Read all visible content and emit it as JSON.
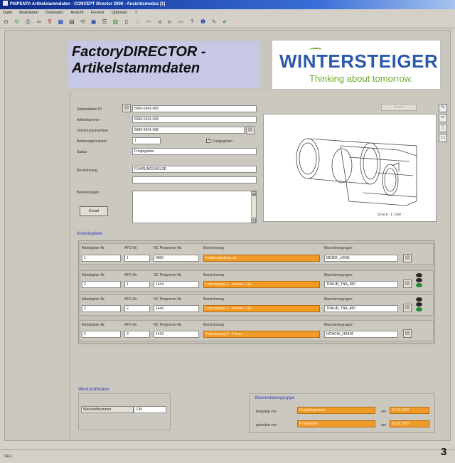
{
  "window": {
    "title": "PSIPENTA Artikelstammdaten - CONCEPT Director 2006 - Ansichtsmodus [1]"
  },
  "menu": [
    "Datei",
    "Bearbeiten",
    "Datensatz",
    "Ansicht",
    "Fenster",
    "Optionen",
    "?"
  ],
  "toolbar": {
    "icons": [
      "back-icon",
      "refresh-icon",
      "print-icon",
      "binoculars-icon",
      "search-icon",
      "grid-icon",
      "table-icon",
      "rotate-icon",
      "save-icon",
      "list-icon",
      "chart-icon",
      "doc-icon",
      "filter-icon",
      "first-icon",
      "prev-icon",
      "next-icon",
      "last-icon",
      "help-icon",
      "info-icon",
      "edit-green-icon",
      "check-green-icon"
    ]
  },
  "header": {
    "title_line1": "FactoryDIRECTOR -",
    "title_line2": "Artikelstammdaten"
  },
  "logo": {
    "name": "WINTERSTEIGER",
    "tagline": "Thinking about tomorrow.",
    "brand_color": "#2d5aa8",
    "accent_color": "#6faa2d"
  },
  "form": {
    "stammdaten_label": "Stammdaten ID",
    "stammdaten_value": "5960-0341-008",
    "artikelnummer_label": "Artikelnummer",
    "artikelnummer_value": "5960-0341-008",
    "zeichnungsnummer_label": "Zeichnungsnummer",
    "zeichnungsnummer_value": "5960-0341-008",
    "aenderungszustand_label": "Änderungszustand",
    "aenderungszustand_value": "1",
    "freigegeben_label": "Freigegeben",
    "freigegeben_checked": "✓",
    "status_label": "Status",
    "status_value": "Freigegeben",
    "bezeichnung_label": "Bezeichnung",
    "bezeichnung_value": "FÜHRUNGSHÜLSE",
    "bemerkungen_label": "Bemerkungen",
    "edit_button": "Email"
  },
  "drawing": {
    "scale_text": "SCALE   1:200",
    "top_button": "Kopie"
  },
  "side_icons": [
    "pen-icon",
    "pencil-icon",
    "doc-icon",
    "folder-icon"
  ],
  "arbeitsplaene": {
    "title": "Arbeitspläne",
    "col_labels": {
      "ap": "Arbeitsplan-Nr.",
      "afo": "AFO-Nr.",
      "nc": "NC Programm-Nr.",
      "bez": "Bezeichnung",
      "mg": "Maschinengruppe"
    },
    "rows": [
      {
        "ap": "1",
        "afo": "1",
        "nc": "0000",
        "bez": "Fräsbearbeitung alt",
        "mg": "MEIER_LONG",
        "traffic": false
      },
      {
        "ap": "2",
        "afo": "1",
        "nc": "1444",
        "bez": "Fräsvorgang 1 - Drehen 1 Sp",
        "mg": "TRAUB_TNA_480",
        "traffic": true
      },
      {
        "ap": "2",
        "afo": "2",
        "nc": "1446",
        "bez": "Fräsvorgang 2 - Drehen 2 Sp",
        "mg": "TRAUB_TNA_480",
        "traffic": true
      },
      {
        "ap": "2",
        "afo": "3",
        "nc": "1410",
        "bez": "Fräsvorgang 3 - Fräsen",
        "mg": "HITACHI_HG400",
        "traffic": false
      }
    ]
  },
  "werkstoff": {
    "title": "Werkstoffdaten",
    "label": "Werkstoffnummer",
    "value": "C45"
  },
  "stamm": {
    "title": "Stammdatengruppe",
    "angelegt_label": "Angelegt von",
    "angelegt_user": "Projektingenieur",
    "angelegt_am_label": "am",
    "angelegt_date": "21.01.2007",
    "geaendert_label": "geändert von",
    "geaendert_user": "Projektleiter",
    "geaendert_am_label": "am",
    "geaendert_date": "05.02.2007"
  },
  "statusbar": {
    "text": "NEU"
  },
  "figure_number": "3"
}
